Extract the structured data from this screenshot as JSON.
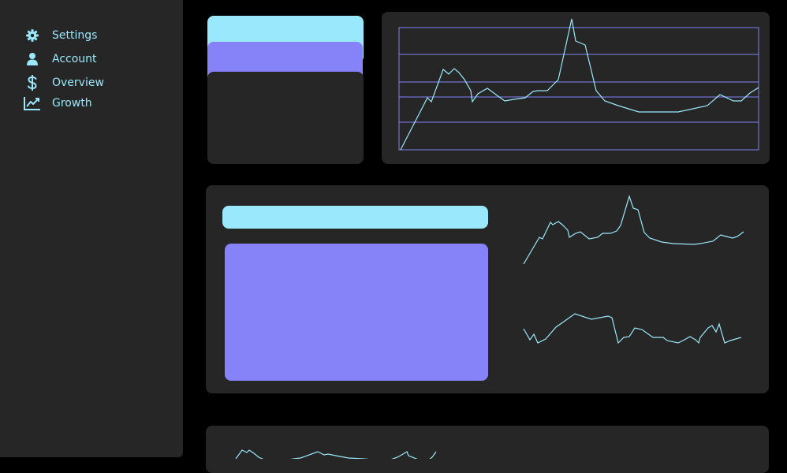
{
  "sidebar": {
    "items": [
      {
        "label": "Settings",
        "icon": "gear-icon"
      },
      {
        "label": "Account",
        "icon": "user-icon"
      },
      {
        "label": "Overview",
        "icon": "dollar-icon"
      },
      {
        "label": "Growth",
        "icon": "chart-line-icon"
      }
    ]
  },
  "colors": {
    "page_background": "#000000",
    "panel": "#262626",
    "accent_cyan": "#9ae8fb",
    "accent_violet": "#8682f8",
    "grid_line": "#8682f8",
    "line_stroke": "#9ae8fb"
  }
}
